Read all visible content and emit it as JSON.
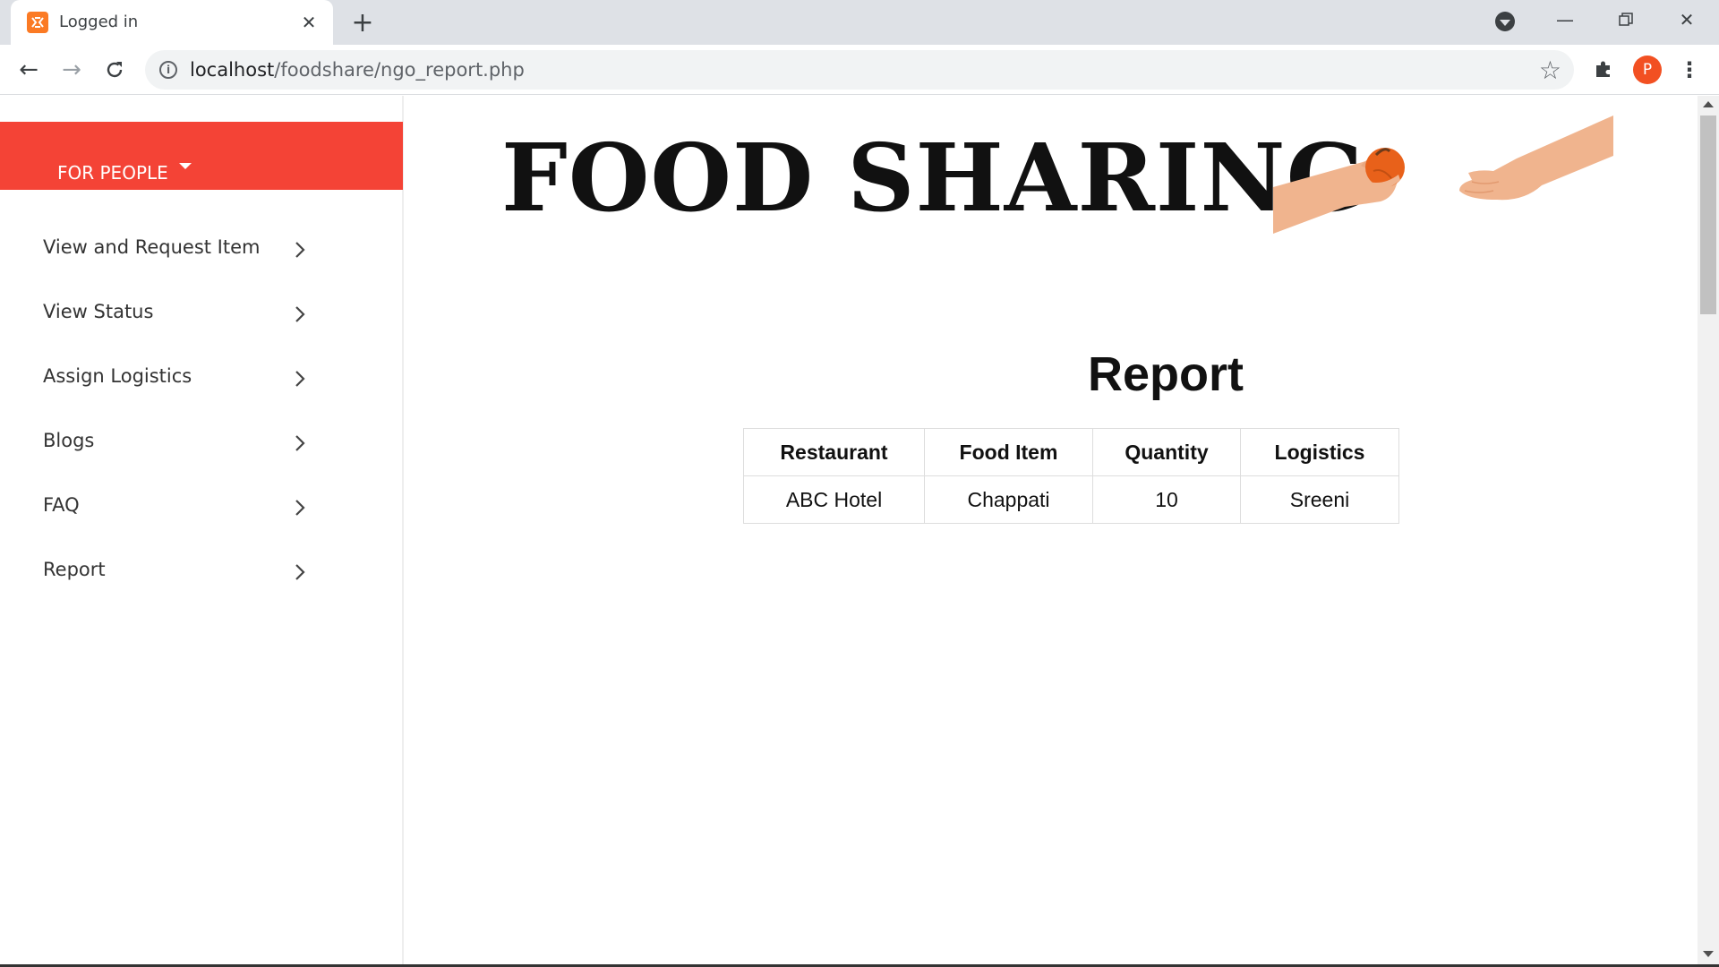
{
  "browser": {
    "tab_title": "Logged in",
    "url_host": "localhost",
    "url_path": "/foodshare/ngo_report.php",
    "profile_initial": "P",
    "icons": {
      "favicon": "xampp-icon",
      "close_tab": "close-icon",
      "new_tab": "plus-icon",
      "back": "arrow-left-icon",
      "forward": "arrow-right-icon",
      "reload": "reload-icon",
      "info": "info-icon",
      "bookmark": "star-icon",
      "extensions": "puzzle-icon",
      "menu": "kebab-menu-icon"
    }
  },
  "sidebar": {
    "header_label": "FOR PEOPLE",
    "accent_color": "#f44336",
    "items": [
      {
        "label": "View and Request Item"
      },
      {
        "label": "View Status"
      },
      {
        "label": "Assign Logistics"
      },
      {
        "label": "Blogs"
      },
      {
        "label": "FAQ"
      },
      {
        "label": "Report"
      }
    ]
  },
  "main": {
    "site_title": "FOOD SHARING",
    "report_heading": "Report",
    "table": {
      "headers": [
        "Restaurant",
        "Food Item",
        "Quantity",
        "Logistics"
      ],
      "rows": [
        [
          "ABC Hotel",
          "Chappati",
          "10",
          "Sreeni"
        ]
      ]
    }
  }
}
